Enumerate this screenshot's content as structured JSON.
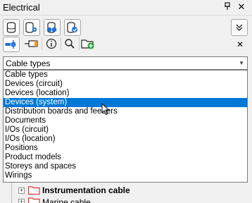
{
  "window": {
    "title": "Electrical",
    "pin_glyph": "ᵠ",
    "close_glyph": "✕"
  },
  "toolbar1": {
    "buttons": [
      {
        "name": "database-icon"
      },
      {
        "name": "database-settings-icon"
      },
      {
        "name": "database-link-icon"
      },
      {
        "name": "database-update-icon"
      }
    ],
    "collapse_glyph": "︾"
  },
  "toolbar2": {
    "close_glyph": "✕"
  },
  "combo": {
    "value": "Cable types",
    "arrow_glyph": "▼"
  },
  "dropdown": {
    "items": [
      "Cable types",
      "Devices (circuit)",
      "Devices (location)",
      "Devices (system)",
      "Distribution boards and feeders",
      "Documents",
      "I/Os (circuit)",
      "I/Os (location)",
      "Positions",
      "Product models",
      "Storeys and spaces",
      "Wirings"
    ],
    "selected_index": 3
  },
  "tree": {
    "rows": [
      {
        "label": "Instrumentation cable",
        "bold": true
      },
      {
        "label": "Marine cable",
        "bold": false
      }
    ]
  },
  "colors": {
    "selection": "#0078d7",
    "folder_red": "#d83b3b",
    "icon_blue": "#1e6fd9"
  }
}
